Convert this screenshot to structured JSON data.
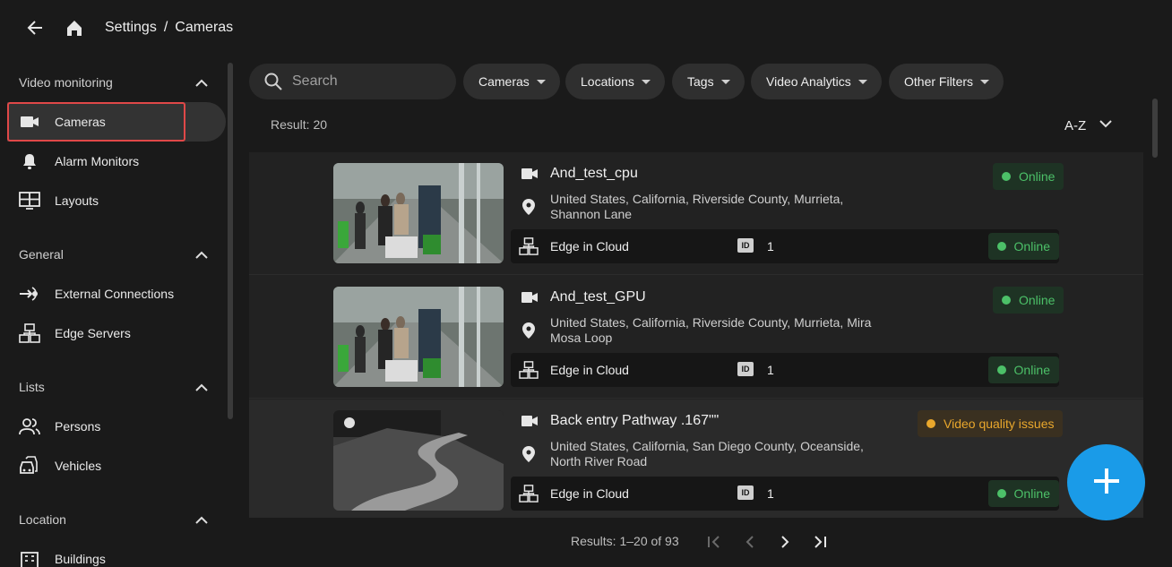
{
  "breadcrumb": {
    "parent": "Settings",
    "separator": "/",
    "current": "Cameras"
  },
  "sidebar": {
    "sections": [
      {
        "title": "Video monitoring",
        "items": [
          {
            "label": "Cameras",
            "icon": "video-camera-icon"
          },
          {
            "label": "Alarm Monitors",
            "icon": "bell-icon"
          },
          {
            "label": "Layouts",
            "icon": "layout-grid-icon"
          }
        ]
      },
      {
        "title": "General",
        "items": [
          {
            "label": "External Connections",
            "icon": "external-connection-icon"
          },
          {
            "label": "Edge Servers",
            "icon": "edge-server-icon"
          }
        ]
      },
      {
        "title": "Lists",
        "items": [
          {
            "label": "Persons",
            "icon": "persons-icon"
          },
          {
            "label": "Vehicles",
            "icon": "vehicle-icon"
          }
        ]
      },
      {
        "title": "Location",
        "items": [
          {
            "label": "Buildings",
            "icon": "building-icon"
          }
        ]
      }
    ]
  },
  "search": {
    "placeholder": "Search"
  },
  "filters": [
    "Cameras",
    "Locations",
    "Tags",
    "Video Analytics",
    "Other Filters"
  ],
  "result_label": "Result: 20",
  "sort_label": "A-Z",
  "cameras": [
    {
      "name": "And_test_cpu",
      "address": "United States, California, Riverside County, Murrieta, Shannon Lane",
      "status": "Online",
      "status_kind": "ok",
      "edge": "Edge in Cloud",
      "id_label": "ID",
      "id": "1",
      "edge_status": "Online"
    },
    {
      "name": "And_test_GPU",
      "address": "United States, California, Riverside County, Murrieta, Mira Mosa Loop",
      "status": "Online",
      "status_kind": "ok",
      "edge": "Edge in Cloud",
      "id_label": "ID",
      "id": "1",
      "edge_status": "Online"
    },
    {
      "name": "Back entry Pathway .167\"\"",
      "address": "United States, California, San Diego County, Oceanside, North River Road",
      "status": "Video quality issues",
      "status_kind": "warn",
      "edge": "Edge in Cloud",
      "id_label": "ID",
      "id": "1",
      "edge_status": "Online"
    }
  ],
  "pagination": {
    "label": "Results: 1–20 of 93"
  },
  "colors": {
    "accent": "#1a9be8",
    "online": "#4cc068",
    "warning": "#e9a72c",
    "selection_outline": "#e04848"
  }
}
